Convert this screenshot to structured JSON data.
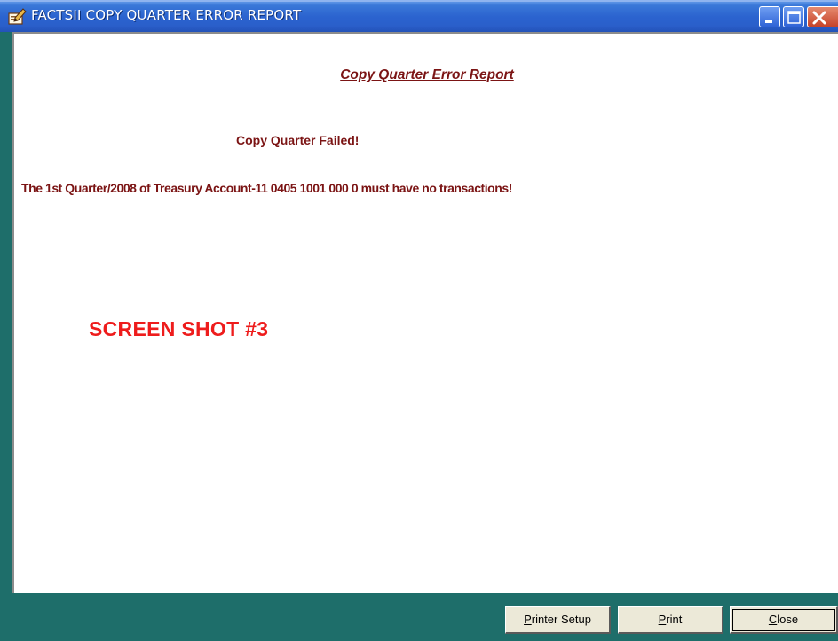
{
  "window": {
    "title": "FACTSII COPY QUARTER ERROR REPORT",
    "icon": "pencil-document-icon",
    "controls": {
      "minimize_icon": "minimize-icon",
      "maximize_icon": "maximize-icon",
      "close_icon": "close-icon"
    },
    "colors": {
      "titlebar": "#2b63cf",
      "frame": "#1e6e6a",
      "close_button": "#c6432a"
    }
  },
  "report": {
    "heading": "Copy Quarter Error Report",
    "status_message": "Copy Quarter Failed!",
    "detail_message": "The 1st Quarter/2008 of Treasury Account-11  0405 1001 000 0 must have no  transactions!",
    "overlay_label": "SCREEN SHOT #3",
    "colors": {
      "text": "#7b1414",
      "overlay": "#ee1c1c"
    }
  },
  "buttons": {
    "printer_setup": {
      "mnemonic": "P",
      "rest": "rinter Setup"
    },
    "print": {
      "mnemonic": "P",
      "rest": "rint"
    },
    "close": {
      "mnemonic": "C",
      "rest": "lose"
    }
  }
}
